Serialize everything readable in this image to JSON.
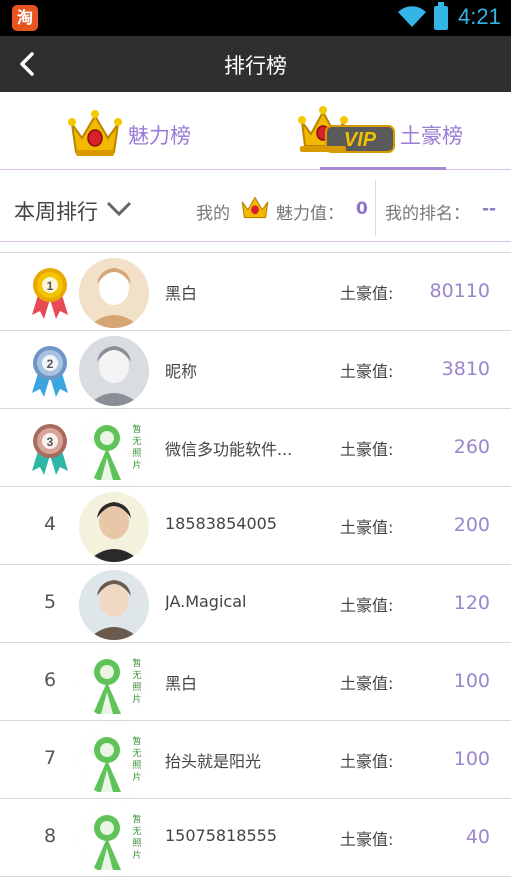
{
  "status_bar": {
    "app_icon_glyph": "淘",
    "time": "4:21",
    "accent": "#33b5e5"
  },
  "header": {
    "title": "排行榜",
    "back_icon": "back-chevron-icon"
  },
  "tabs": [
    {
      "label": "魅力榜",
      "icon": "crown-icon",
      "selected": false
    },
    {
      "label": "土豪榜",
      "icon": "vip-crown-icon",
      "badge": "VIP",
      "selected": true
    }
  ],
  "filter": {
    "period_label": "本周排行",
    "my_prefix": "我的",
    "my_charm_label": "魅力值：",
    "my_charm_value": "0",
    "my_rank_label": "我的排名：",
    "my_rank_value": "--"
  },
  "score_label": "土豪值:",
  "rows": [
    {
      "rank": "1",
      "medal": "gold",
      "avatar": "photo-girl",
      "name": "黑白",
      "score": "80110"
    },
    {
      "rank": "2",
      "medal": "silver",
      "avatar": "photo-room",
      "name": "昵称",
      "score": "3810"
    },
    {
      "rank": "3",
      "medal": "bronze",
      "avatar": "placeholder",
      "name": "微信多功能软件...",
      "score": "260"
    },
    {
      "rank": "4",
      "medal": null,
      "avatar": "photo-boy",
      "name": "18583854005",
      "score": "200"
    },
    {
      "rank": "5",
      "medal": null,
      "avatar": "photo-face",
      "name": "JA.Magical",
      "score": "120"
    },
    {
      "rank": "6",
      "medal": null,
      "avatar": "placeholder",
      "name": "黑白",
      "score": "100"
    },
    {
      "rank": "7",
      "medal": null,
      "avatar": "placeholder",
      "name": "抬头就是阳光",
      "score": "100"
    },
    {
      "rank": "8",
      "medal": null,
      "avatar": "placeholder",
      "name": "15075818555",
      "score": "40"
    }
  ],
  "placeholder_text": "暂无照片",
  "colors": {
    "accent_purple": "#9a7cd6",
    "score_purple": "#9a86cc",
    "gold": "#f2b900",
    "silver": "#9fb7d6",
    "bronze": "#c8948a"
  }
}
